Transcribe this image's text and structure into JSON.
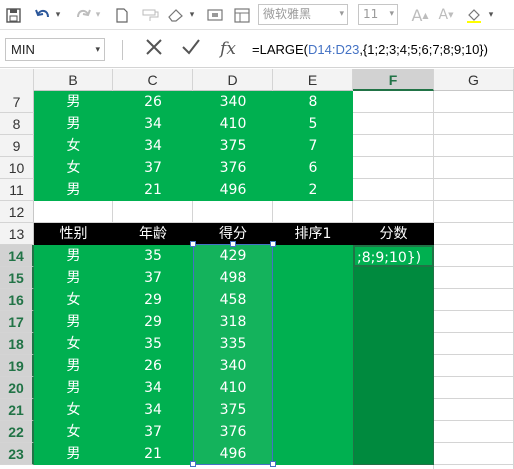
{
  "ribbon": {
    "font_name": "微软雅黑",
    "font_size": "11"
  },
  "formula_bar": {
    "name_box": "MIN",
    "fx_label": "fx",
    "formula_prefix": "=LARGE(",
    "formula_ref": "D14:D23",
    "formula_suffix": ",{1;2;3;4;5;6;7;8;9;10})"
  },
  "columns": [
    "B",
    "C",
    "D",
    "E",
    "F",
    "G"
  ],
  "top_rows": [
    {
      "row": "7",
      "gender": "男",
      "age": "26",
      "score": "340",
      "rank": "8"
    },
    {
      "row": "8",
      "gender": "男",
      "age": "34",
      "score": "410",
      "rank": "5"
    },
    {
      "row": "9",
      "gender": "女",
      "age": "34",
      "score": "375",
      "rank": "7"
    },
    {
      "row": "10",
      "gender": "女",
      "age": "37",
      "score": "376",
      "rank": "6"
    },
    {
      "row": "11",
      "gender": "男",
      "age": "21",
      "score": "496",
      "rank": "2"
    }
  ],
  "empty_row": "12",
  "header_row": {
    "row": "13",
    "gender": "性别",
    "age": "年龄",
    "score": "得分",
    "rank": "排序1",
    "points": "分数"
  },
  "bottom_rows": [
    {
      "row": "14",
      "gender": "男",
      "age": "35",
      "score": "429"
    },
    {
      "row": "15",
      "gender": "男",
      "age": "37",
      "score": "498"
    },
    {
      "row": "16",
      "gender": "女",
      "age": "29",
      "score": "458"
    },
    {
      "row": "17",
      "gender": "男",
      "age": "29",
      "score": "318"
    },
    {
      "row": "18",
      "gender": "女",
      "age": "35",
      "score": "335"
    },
    {
      "row": "19",
      "gender": "男",
      "age": "26",
      "score": "340"
    },
    {
      "row": "20",
      "gender": "男",
      "age": "34",
      "score": "410"
    },
    {
      "row": "21",
      "gender": "女",
      "age": "34",
      "score": "375"
    },
    {
      "row": "22",
      "gender": "女",
      "age": "37",
      "score": "376"
    },
    {
      "row": "23",
      "gender": "男",
      "age": "21",
      "score": "496"
    }
  ],
  "active_cell_text": ";8;9;10})",
  "colors": {
    "green": "#00b050",
    "dark_green": "#008a3e",
    "header_black": "#000000",
    "selection_blue": "#4472c4"
  }
}
